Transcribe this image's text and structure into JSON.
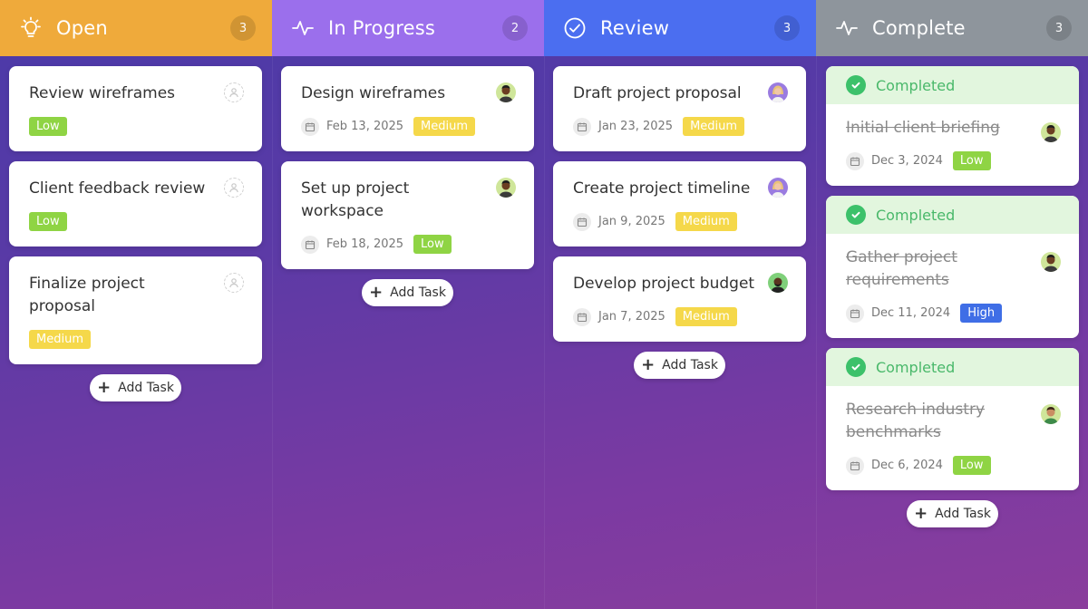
{
  "columns": [
    {
      "title": "Open",
      "count": "3",
      "color": "#efaa3b",
      "icon": "lightbulb-icon",
      "cards": [
        {
          "title": "Review wireframes",
          "date": "",
          "priority": "Low",
          "avatar": "unassigned-avatar"
        },
        {
          "title": "Client feedback review",
          "date": "",
          "priority": "Low",
          "avatar": "unassigned-avatar"
        },
        {
          "title": "Finalize project proposal",
          "date": "",
          "priority": "Medium",
          "avatar": "unassigned-avatar"
        }
      ],
      "add_label": "Add Task"
    },
    {
      "title": "In Progress",
      "count": "2",
      "color": "#9b6fec",
      "icon": "activity-icon",
      "cards": [
        {
          "title": "Design wireframes",
          "date": "Feb 13, 2025",
          "priority": "Medium",
          "avatar": "user-avatar"
        },
        {
          "title": "Set up project workspace",
          "date": "Feb 18, 2025",
          "priority": "Low",
          "avatar": "user-avatar"
        }
      ],
      "add_label": "Add Task"
    },
    {
      "title": "Review",
      "count": "3",
      "color": "#4b6ef0",
      "icon": "check-circle-icon",
      "cards": [
        {
          "title": "Draft project proposal",
          "date": "Jan 23, 2025",
          "priority": "Medium",
          "avatar": "user-avatar"
        },
        {
          "title": "Create project timeline",
          "date": "Jan 9, 2025",
          "priority": "Medium",
          "avatar": "user-avatar"
        },
        {
          "title": "Develop project budget",
          "date": "Jan 7, 2025",
          "priority": "Medium",
          "avatar": "user-avatar"
        }
      ],
      "add_label": "Add Task"
    },
    {
      "title": "Complete",
      "count": "3",
      "color": "#8e959c",
      "icon": "activity-icon",
      "cards": [
        {
          "completed_label": "Completed",
          "title": "Initial client briefing",
          "date": "Dec 3, 2024",
          "priority": "Low",
          "avatar": "user-avatar"
        },
        {
          "completed_label": "Completed",
          "title": "Gather project requirements",
          "date": "Dec 11, 2024",
          "priority": "High",
          "avatar": "user-avatar"
        },
        {
          "completed_label": "Completed",
          "title": "Research industry benchmarks",
          "date": "Dec 6, 2024",
          "priority": "Low",
          "avatar": "user-avatar"
        }
      ],
      "add_label": "Add Task"
    }
  ]
}
